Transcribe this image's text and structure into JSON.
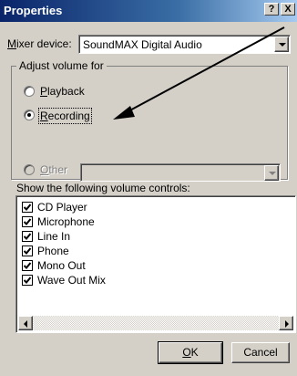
{
  "window": {
    "title": "Properties",
    "help_button": "?",
    "close_button": "X"
  },
  "mixer": {
    "label": "Mixer device:",
    "value": "SoundMAX Digital Audio"
  },
  "adjust_volume": {
    "group_title": "Adjust volume for",
    "options": [
      {
        "label": "Playback",
        "selected": false,
        "enabled": true
      },
      {
        "label": "Recording",
        "selected": true,
        "enabled": true
      },
      {
        "label": "Other",
        "selected": false,
        "enabled": false
      }
    ],
    "other_select_value": ""
  },
  "controls": {
    "label": "Show the following volume controls:",
    "items": [
      {
        "label": "CD Player",
        "checked": true
      },
      {
        "label": "Microphone",
        "checked": true
      },
      {
        "label": "Line In",
        "checked": true
      },
      {
        "label": "Phone",
        "checked": true
      },
      {
        "label": "Mono Out",
        "checked": true
      },
      {
        "label": "Wave Out Mix",
        "checked": true
      }
    ]
  },
  "buttons": {
    "ok": "OK",
    "cancel": "Cancel"
  },
  "colors": {
    "annotation_arrow": "#000000",
    "title_bar": "#0a246a"
  }
}
